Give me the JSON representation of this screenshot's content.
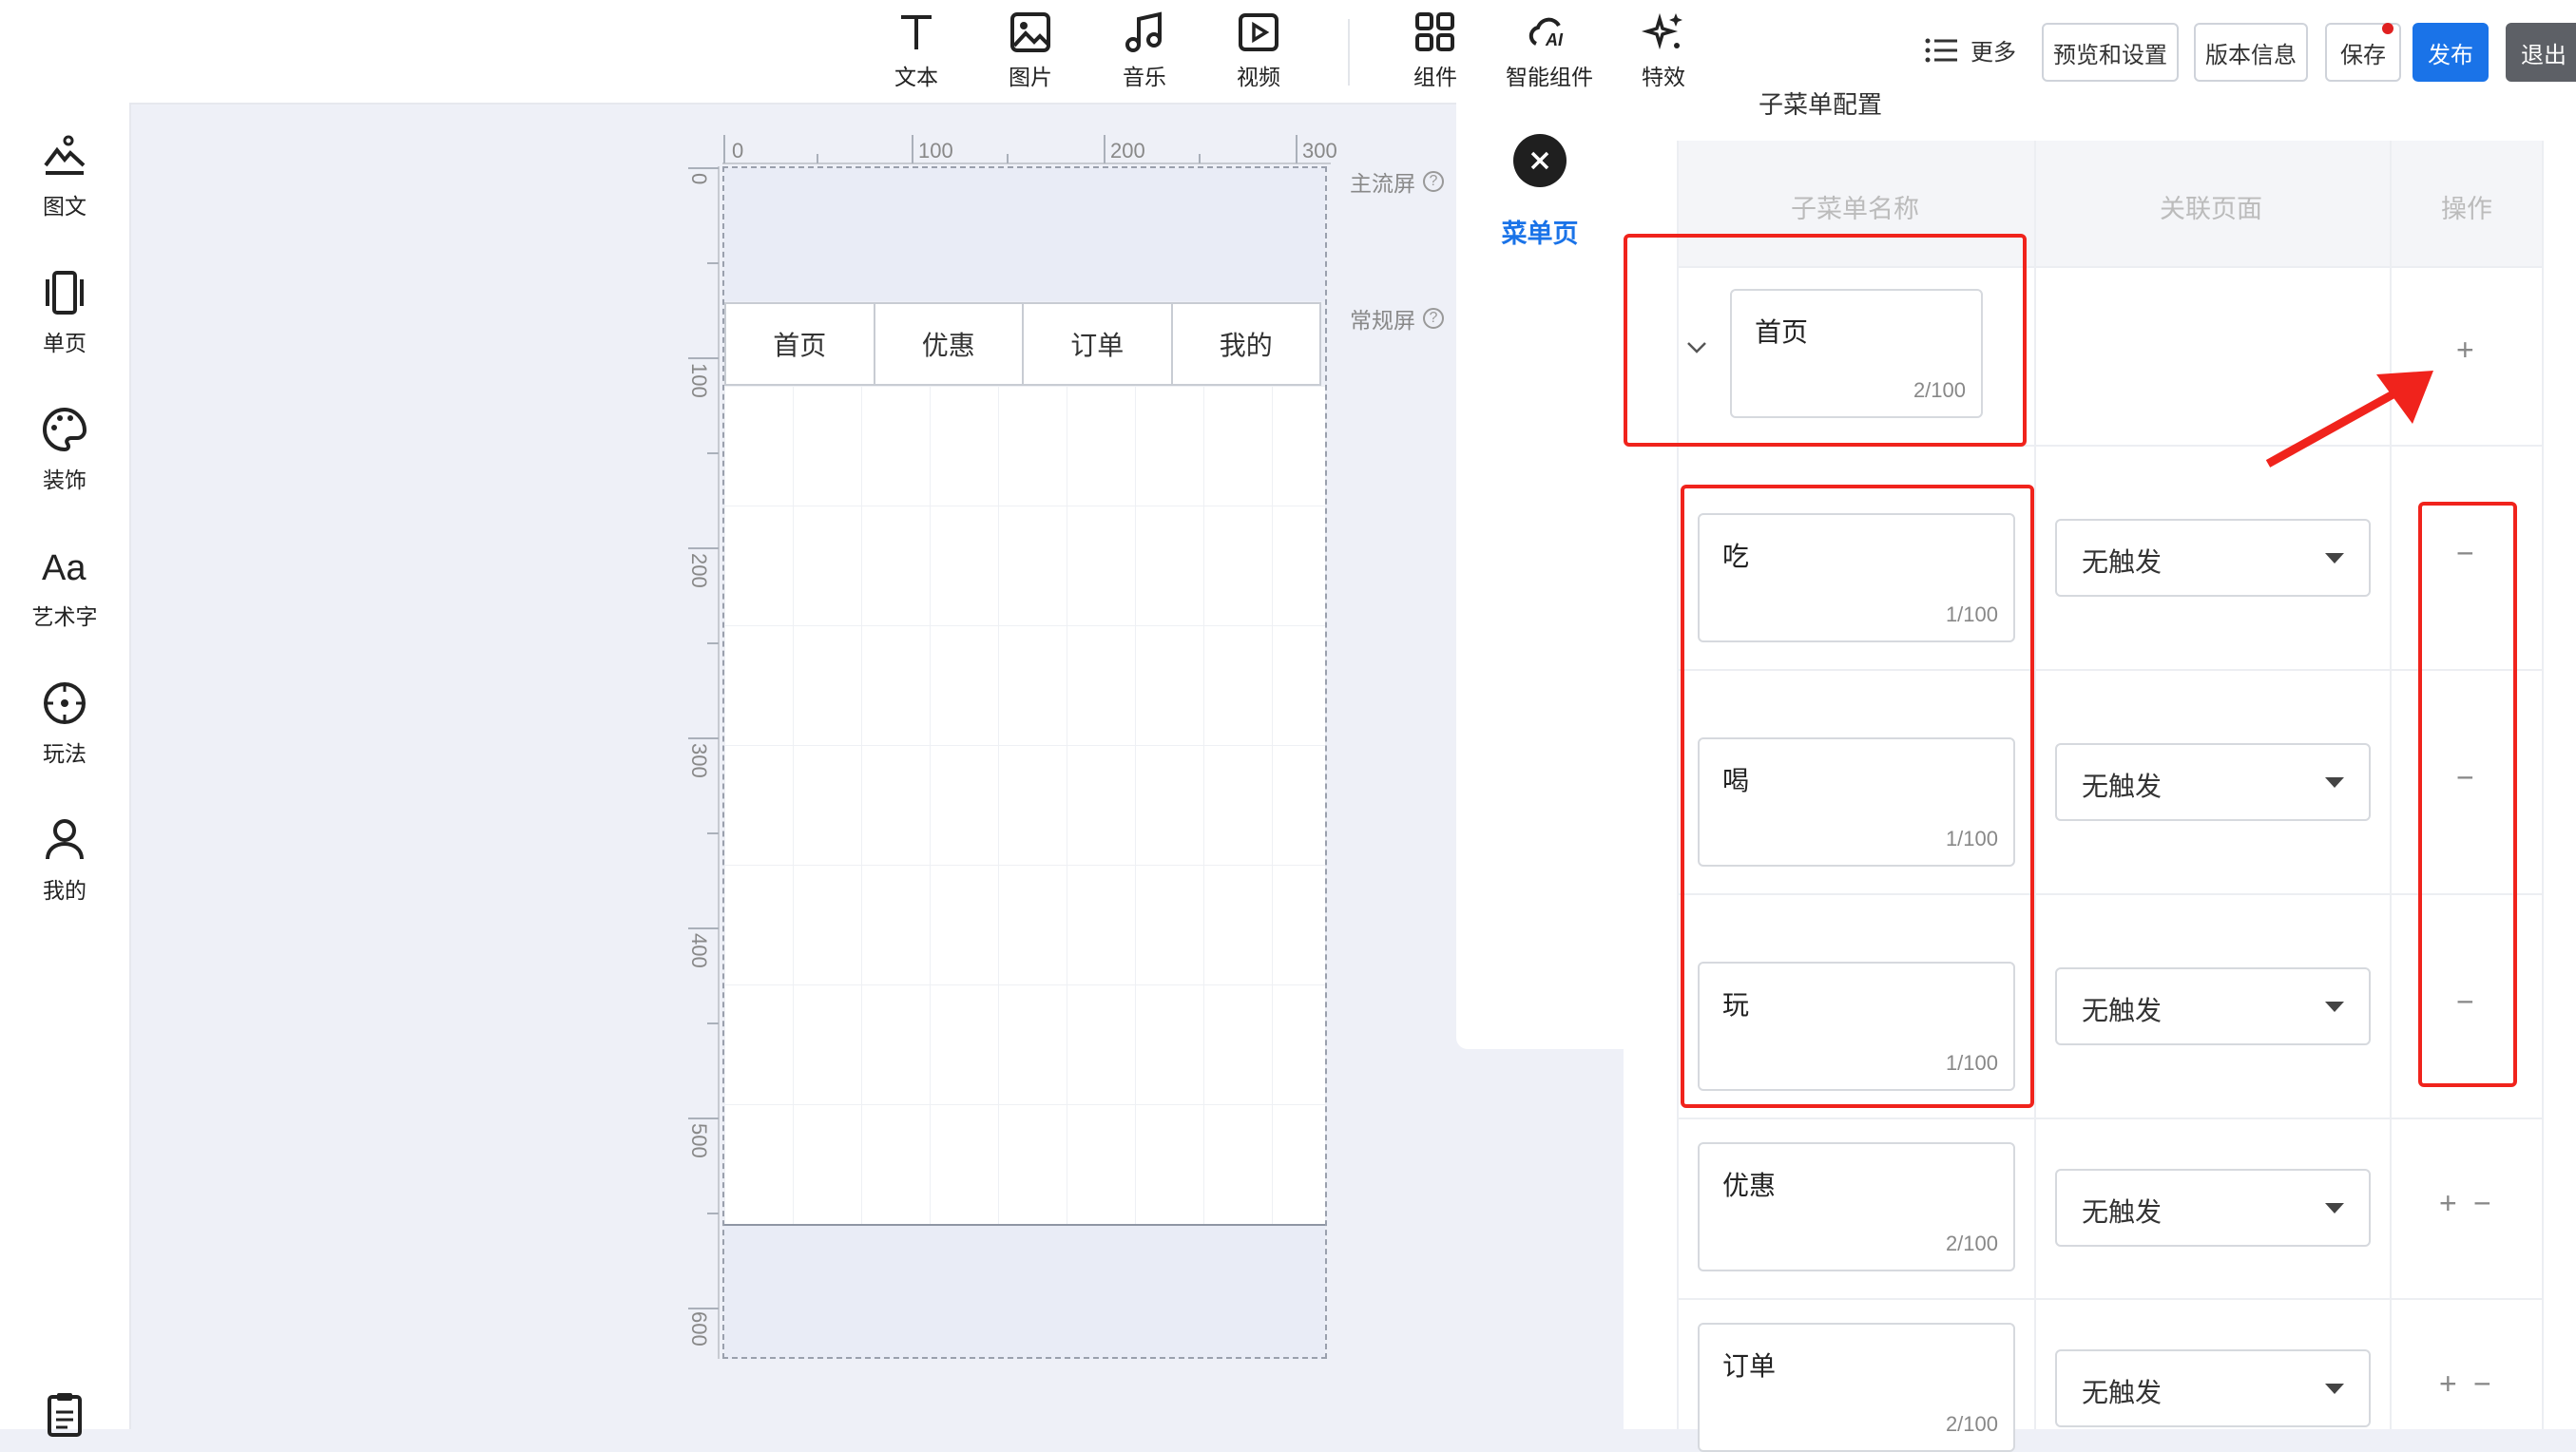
{
  "toolbar": {
    "tools": [
      {
        "icon": "text-icon",
        "label": "文本"
      },
      {
        "icon": "image-icon",
        "label": "图片"
      },
      {
        "icon": "music-icon",
        "label": "音乐"
      },
      {
        "icon": "video-icon",
        "label": "视频"
      },
      {
        "icon": "components-icon",
        "label": "组件"
      },
      {
        "icon": "ai-components-icon",
        "label": "智能组件"
      },
      {
        "icon": "effects-icon",
        "label": "特效"
      }
    ],
    "more_label": "更多",
    "preview_label": "预览和设置",
    "version_label": "版本信息",
    "save_label": "保存",
    "publish_label": "发布",
    "exit_label": "退出"
  },
  "sidebar": {
    "items": [
      {
        "icon": "image-text-icon",
        "label": "图文"
      },
      {
        "icon": "single-page-icon",
        "label": "单页"
      },
      {
        "icon": "palette-icon",
        "label": "装饰"
      },
      {
        "icon": "art-text-icon",
        "label": "艺术字"
      },
      {
        "icon": "gameplay-icon",
        "label": "玩法"
      },
      {
        "icon": "user-icon",
        "label": "我的"
      }
    ],
    "bottom_icon": "clipboard-icon"
  },
  "canvas": {
    "ruler_h": [
      "0",
      "100",
      "200",
      "300"
    ],
    "ruler_v": [
      "0",
      "100",
      "200",
      "300",
      "400",
      "500",
      "600"
    ],
    "main_screen_label": "主流屏",
    "normal_screen_label": "常规屏",
    "tabs": [
      "首页",
      "优惠",
      "订单",
      "我的"
    ]
  },
  "middle_panel": {
    "menu_page_label": "菜单页"
  },
  "right_panel": {
    "section_title": "子菜单配置",
    "headers": {
      "name": "子菜单名称",
      "page": "关联页面",
      "action": "操作"
    },
    "parent_row": {
      "name": "首页",
      "count": "2/100",
      "action": "+"
    },
    "sub_rows": [
      {
        "name": "吃",
        "count": "1/100",
        "page": "无触发",
        "action": "−"
      },
      {
        "name": "喝",
        "count": "1/100",
        "page": "无触发",
        "action": "−"
      },
      {
        "name": "玩",
        "count": "1/100",
        "page": "无触发",
        "action": "−"
      }
    ],
    "other_rows": [
      {
        "name": "优惠",
        "count": "2/100",
        "page": "无触发",
        "action_add": "+",
        "action_remove": "−"
      },
      {
        "name": "订单",
        "count": "2/100",
        "page": "无触发",
        "action_add": "+",
        "action_remove": "−"
      }
    ]
  },
  "colors": {
    "accent": "#1a73e8",
    "annotation_red": "#f0231c"
  }
}
